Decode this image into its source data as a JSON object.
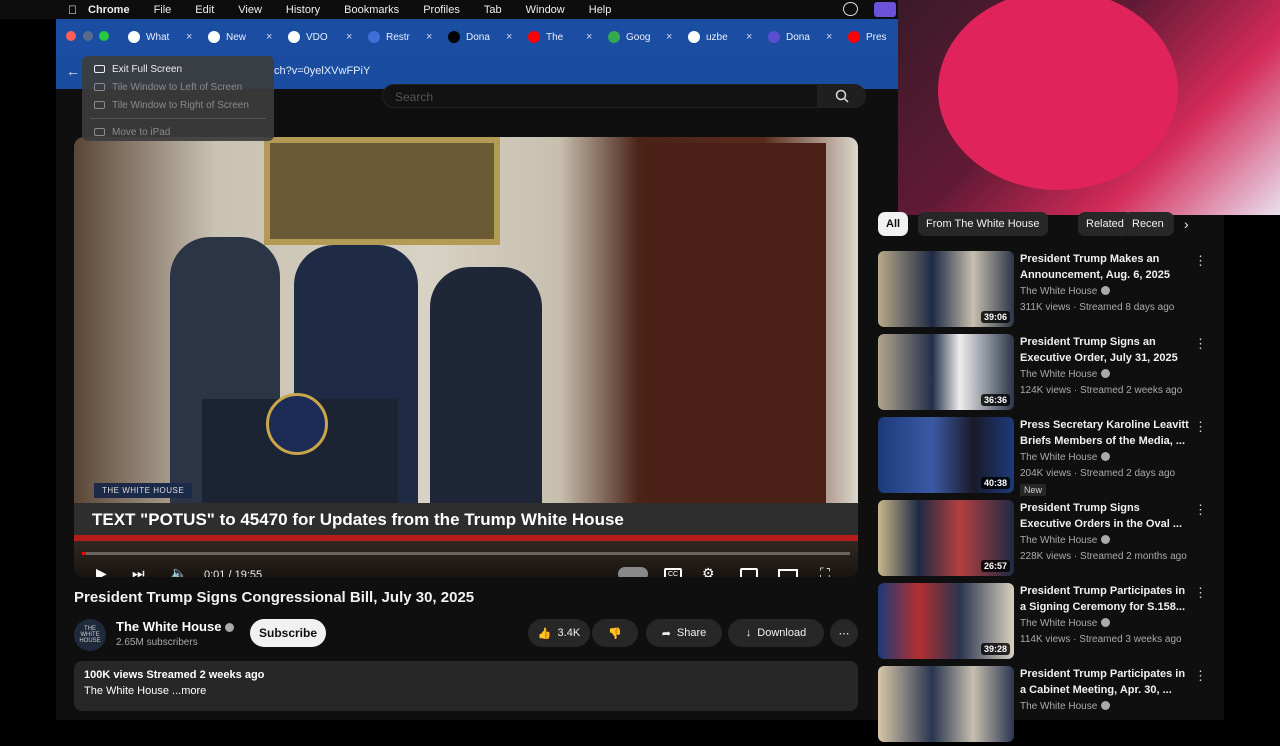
{
  "menubar": {
    "app": "Chrome",
    "items": [
      "File",
      "Edit",
      "View",
      "History",
      "Bookmarks",
      "Profiles",
      "Tab",
      "Window",
      "Help"
    ]
  },
  "tabs": [
    {
      "label": "What",
      "icon": "chrome-icon",
      "color": "#ffffff"
    },
    {
      "label": "New",
      "icon": "chrome-icon",
      "color": "#ffffff"
    },
    {
      "label": "VDO",
      "icon": "vdo-icon",
      "color": "#ffffff"
    },
    {
      "label": "Restr",
      "icon": "r-icon",
      "color": "#3f6ed8"
    },
    {
      "label": "Dona",
      "icon": "x-icon",
      "color": "#000000"
    },
    {
      "label": "The",
      "icon": "youtube-icon",
      "color": "#ff0000"
    },
    {
      "label": "Goog",
      "icon": "maps-icon",
      "color": "#34a853"
    },
    {
      "label": "uzbe",
      "icon": "google-icon",
      "color": "#ffffff"
    },
    {
      "label": "Dona",
      "icon": "t-icon",
      "color": "#5b4fd1"
    },
    {
      "label": "Pres",
      "icon": "youtube-icon",
      "color": "#ff0000"
    }
  ],
  "address": {
    "url": "ch?v=0yelXVwFPiY"
  },
  "search": {
    "placeholder": "Search"
  },
  "context_menu": {
    "items": [
      {
        "label": "Exit Full Screen",
        "enabled": true
      },
      {
        "label": "Tile Window to Left of Screen",
        "enabled": false
      },
      {
        "label": "Tile Window to Right of Screen",
        "enabled": false
      },
      {
        "label": "Move to iPad",
        "enabled": false
      }
    ]
  },
  "player": {
    "caption": "TEXT \"POTUS\" to 45470 for Updates from the Trump White House",
    "channel_watermark": "THE WHITE HOUSE",
    "time": "0:01 / 19:55",
    "progress_fraction": 0.0009
  },
  "video": {
    "title": "President Trump Signs Congressional Bill, July 30, 2025",
    "channel": "The White House",
    "subscribers": "2.65M subscribers",
    "subscribe_label": "Subscribe",
    "likes": "3.4K",
    "share_label": "Share",
    "download_label": "Download",
    "views_meta": "100K views  Streamed 2 weeks ago",
    "description": "The White House ...more",
    "avatar_text": "THE WHITE HOUSE"
  },
  "chips": [
    "All",
    "From The White House",
    "Related",
    "Recen"
  ],
  "recommendations": [
    {
      "title": "President Trump Makes an Announcement, Aug. 6, 2025",
      "channel": "The White House",
      "views": "311K views · Streamed 8 days ago",
      "duration": "39:06",
      "new": ""
    },
    {
      "title": "President Trump Signs an Executive Order, July 31, 2025",
      "channel": "The White House",
      "views": "124K views · Streamed 2 weeks ago",
      "duration": "36:36",
      "new": ""
    },
    {
      "title": "Press Secretary Karoline Leavitt Briefs Members of the Media, ...",
      "channel": "The White House",
      "views": "204K views · Streamed 2 days ago",
      "duration": "40:38",
      "new": "New"
    },
    {
      "title": "President Trump Signs Executive Orders in the Oval ...",
      "channel": "The White House",
      "views": "228K views · Streamed 2 months ago",
      "duration": "26:57",
      "new": ""
    },
    {
      "title": "President Trump Participates in a Signing Ceremony for S.158...",
      "channel": "The White House",
      "views": "114K views · Streamed 3 weeks ago",
      "duration": "39:28",
      "new": ""
    },
    {
      "title": "President Trump Participates in a Cabinet Meeting, Apr. 30, ...",
      "channel": "The White House",
      "views": "",
      "duration": "",
      "new": ""
    }
  ],
  "colors": {
    "accent_red": "#ff0000",
    "tabbar_blue": "#1b4ea3",
    "yt_bg": "#0f0f0f"
  }
}
